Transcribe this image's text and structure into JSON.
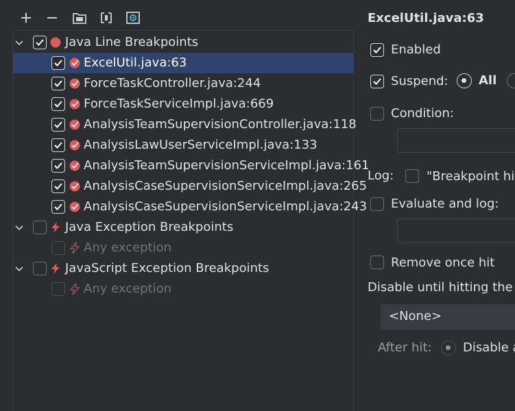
{
  "toolbar": {
    "buttons": [
      {
        "icon": "add-icon"
      },
      {
        "icon": "remove-icon"
      },
      {
        "icon": "group-folder-icon"
      },
      {
        "icon": "export-icon"
      },
      {
        "icon": "import-icon"
      }
    ]
  },
  "tree": {
    "java_line": {
      "label": "Java Line Breakpoints",
      "checked": true,
      "items": [
        {
          "label": "ExcelUtil.java:63",
          "checked": true,
          "selected": true
        },
        {
          "label": "ForceTaskController.java:244",
          "checked": true
        },
        {
          "label": "ForceTaskServiceImpl.java:669",
          "checked": true
        },
        {
          "label": "AnalysisTeamSupervisionController.java:118",
          "checked": true
        },
        {
          "label": "AnalysisLawUserServiceImpl.java:133",
          "checked": true
        },
        {
          "label": "AnalysisTeamSupervisionServiceImpl.java:161",
          "checked": true
        },
        {
          "label": "AnalysisCaseSupervisionServiceImpl.java:265",
          "checked": true
        },
        {
          "label": "AnalysisCaseSupervisionServiceImpl.java:243",
          "checked": true
        }
      ]
    },
    "java_exception": {
      "label": "Java Exception Breakpoints",
      "checked": false,
      "child": "Any exception"
    },
    "js_exception": {
      "label": "JavaScript Exception Breakpoints",
      "checked": false,
      "child": "Any exception"
    }
  },
  "details": {
    "title": "ExcelUtil.java:63",
    "enabled": "Enabled",
    "suspend": "Suspend:",
    "suspend_all": "All",
    "condition": "Condition:",
    "log": "Log:",
    "breakpoint_hit": "\"Breakpoint hit",
    "evaluate_and_log": "Evaluate and log:",
    "remove_once_hit": "Remove once hit",
    "disable_until": "Disable until hitting the f",
    "none_option": "<None>",
    "after_hit": "After hit:",
    "disable_again": "Disable a"
  },
  "colors": {
    "background": "#2b2d30",
    "selection": "#2e436e",
    "breakpoint_red": "#db5c5c",
    "text": "#dfe1e5",
    "dim_text": "#6f737a"
  }
}
